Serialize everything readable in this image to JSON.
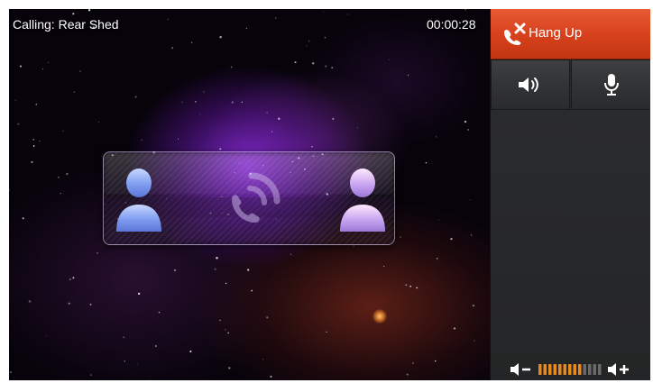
{
  "call": {
    "title": "Calling: Rear Shed",
    "timer": "00:00:28",
    "state": "ringing"
  },
  "controls": {
    "hangup_label": "Hang Up",
    "hangup_icon": "phone-hangup-icon",
    "speaker_icon": "speaker-icon",
    "mic_icon": "microphone-icon",
    "volume_down_icon": "volume-down-icon",
    "volume_up_icon": "volume-up-icon",
    "volume_level": 0.7,
    "volume_segments": 13
  },
  "colors": {
    "hangup": "#d6401c",
    "panel": "#2b2c2e",
    "volume_active": "#e8891e",
    "volume_inactive": "#6a6a6a"
  }
}
